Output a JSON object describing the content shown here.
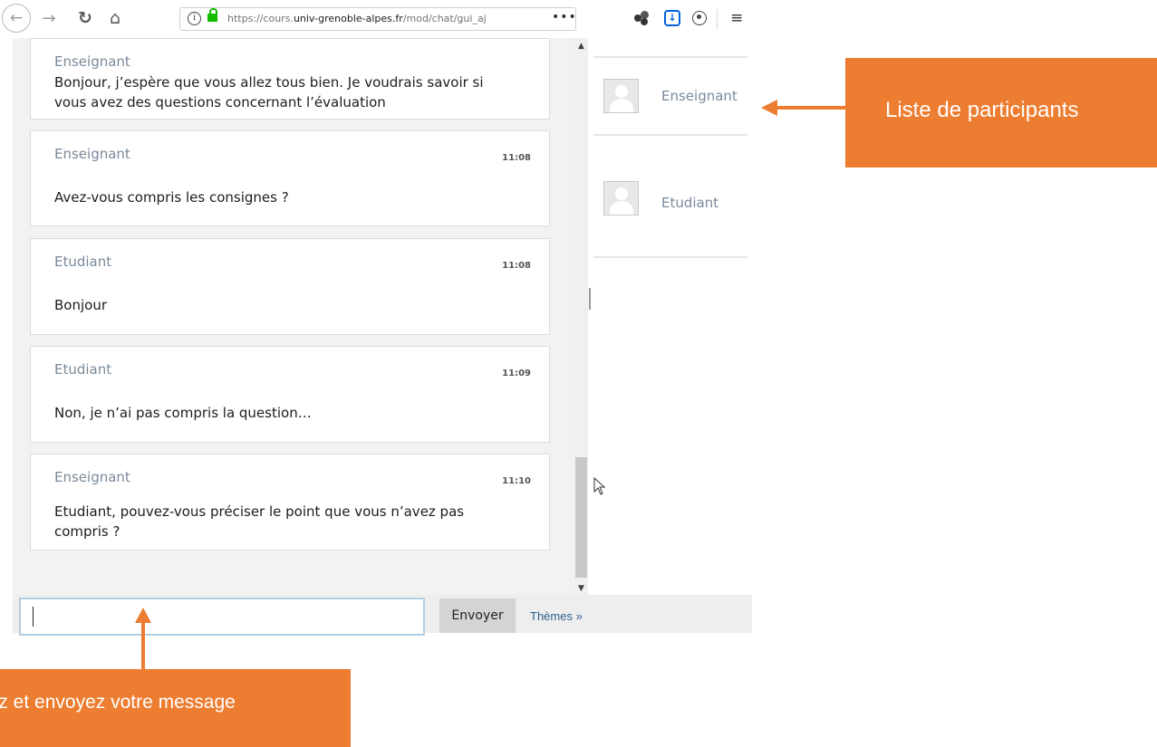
{
  "browser": {
    "url_prefix": "https://cours.",
    "url_domain": "univ-grenoble-alpes.fr",
    "url_path": "/mod/chat/gui_aj",
    "more_label": "•••",
    "menu_label": "≡"
  },
  "messages": [
    {
      "author": "Enseignant",
      "time": "",
      "text": "Bonjour, j’espère que vous allez tous bien. Je voudrais savoir si vous avez des questions concernant l’évaluation"
    },
    {
      "author": "Enseignant",
      "time": "11:08",
      "text": "Avez-vous compris les consignes ?"
    },
    {
      "author": "Etudiant",
      "time": "11:08",
      "text": "Bonjour"
    },
    {
      "author": "Etudiant",
      "time": "11:09",
      "text": "Non, je n’ai pas compris la question…"
    },
    {
      "author": "Enseignant",
      "time": "11:10",
      "text": "Etudiant, pouvez-vous préciser le point que vous n’avez pas compris ?"
    }
  ],
  "participants": [
    {
      "name": "Enseignant"
    },
    {
      "name": "Etudiant"
    }
  ],
  "input": {
    "value": "",
    "send_label": "Envoyer",
    "themes_label": "Thèmes »"
  },
  "annotations": {
    "participants_label": "Liste de participants",
    "message_label": "Ecrivez et envoyez votre message"
  },
  "colors": {
    "accent": "#ed7d31",
    "author_text": "#7a8a9b",
    "link": "#2d5f8a"
  }
}
